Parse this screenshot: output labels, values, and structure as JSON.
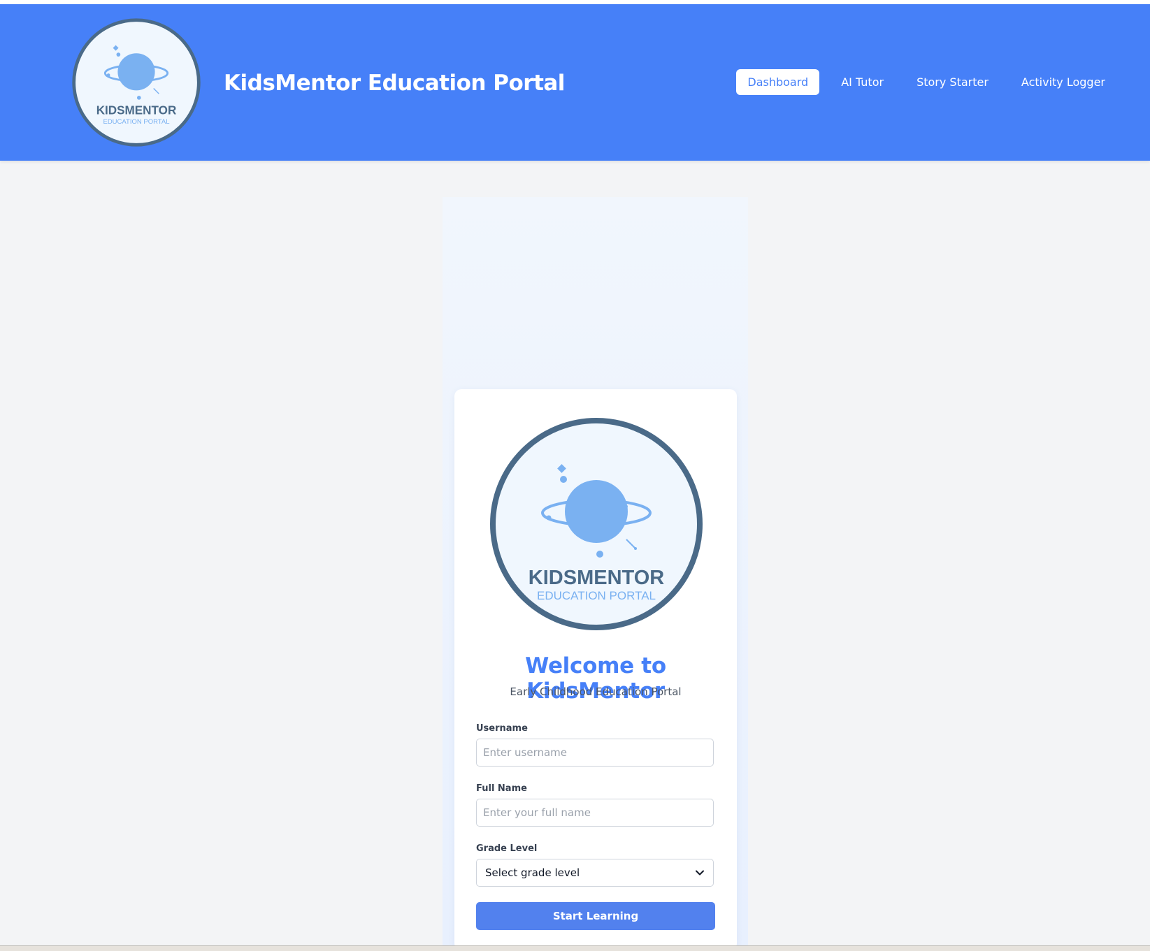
{
  "header": {
    "brand_title": "KidsMentor Education Portal",
    "logo": {
      "name": "KIDSMENTOR",
      "tagline": "EDUCATION PORTAL"
    }
  },
  "nav": {
    "items": [
      {
        "label": "Dashboard",
        "active": true
      },
      {
        "label": "AI Tutor",
        "active": false
      },
      {
        "label": "Story Starter",
        "active": false
      },
      {
        "label": "Activity Logger",
        "active": false
      }
    ]
  },
  "login": {
    "logo": {
      "name": "KIDSMENTOR",
      "tagline": "EDUCATION PORTAL"
    },
    "title": "Welcome to KidsMentor",
    "subtitle": "Early Childhood Education Portal",
    "username": {
      "label": "Username",
      "placeholder": "Enter username",
      "value": ""
    },
    "fullname": {
      "label": "Full Name",
      "placeholder": "Enter your full name",
      "value": ""
    },
    "grade": {
      "label": "Grade Level",
      "selected": "Select grade level"
    },
    "submit_label": "Start Learning"
  },
  "colors": {
    "primary": "#4680f8",
    "button": "#5281ee",
    "logo_ring": "#4a6a88",
    "planet": "#7ab1f1",
    "page_bg": "#f3f4f6"
  },
  "icons": {
    "logo": "planet-logo-icon",
    "select": "chevron-down-icon"
  }
}
